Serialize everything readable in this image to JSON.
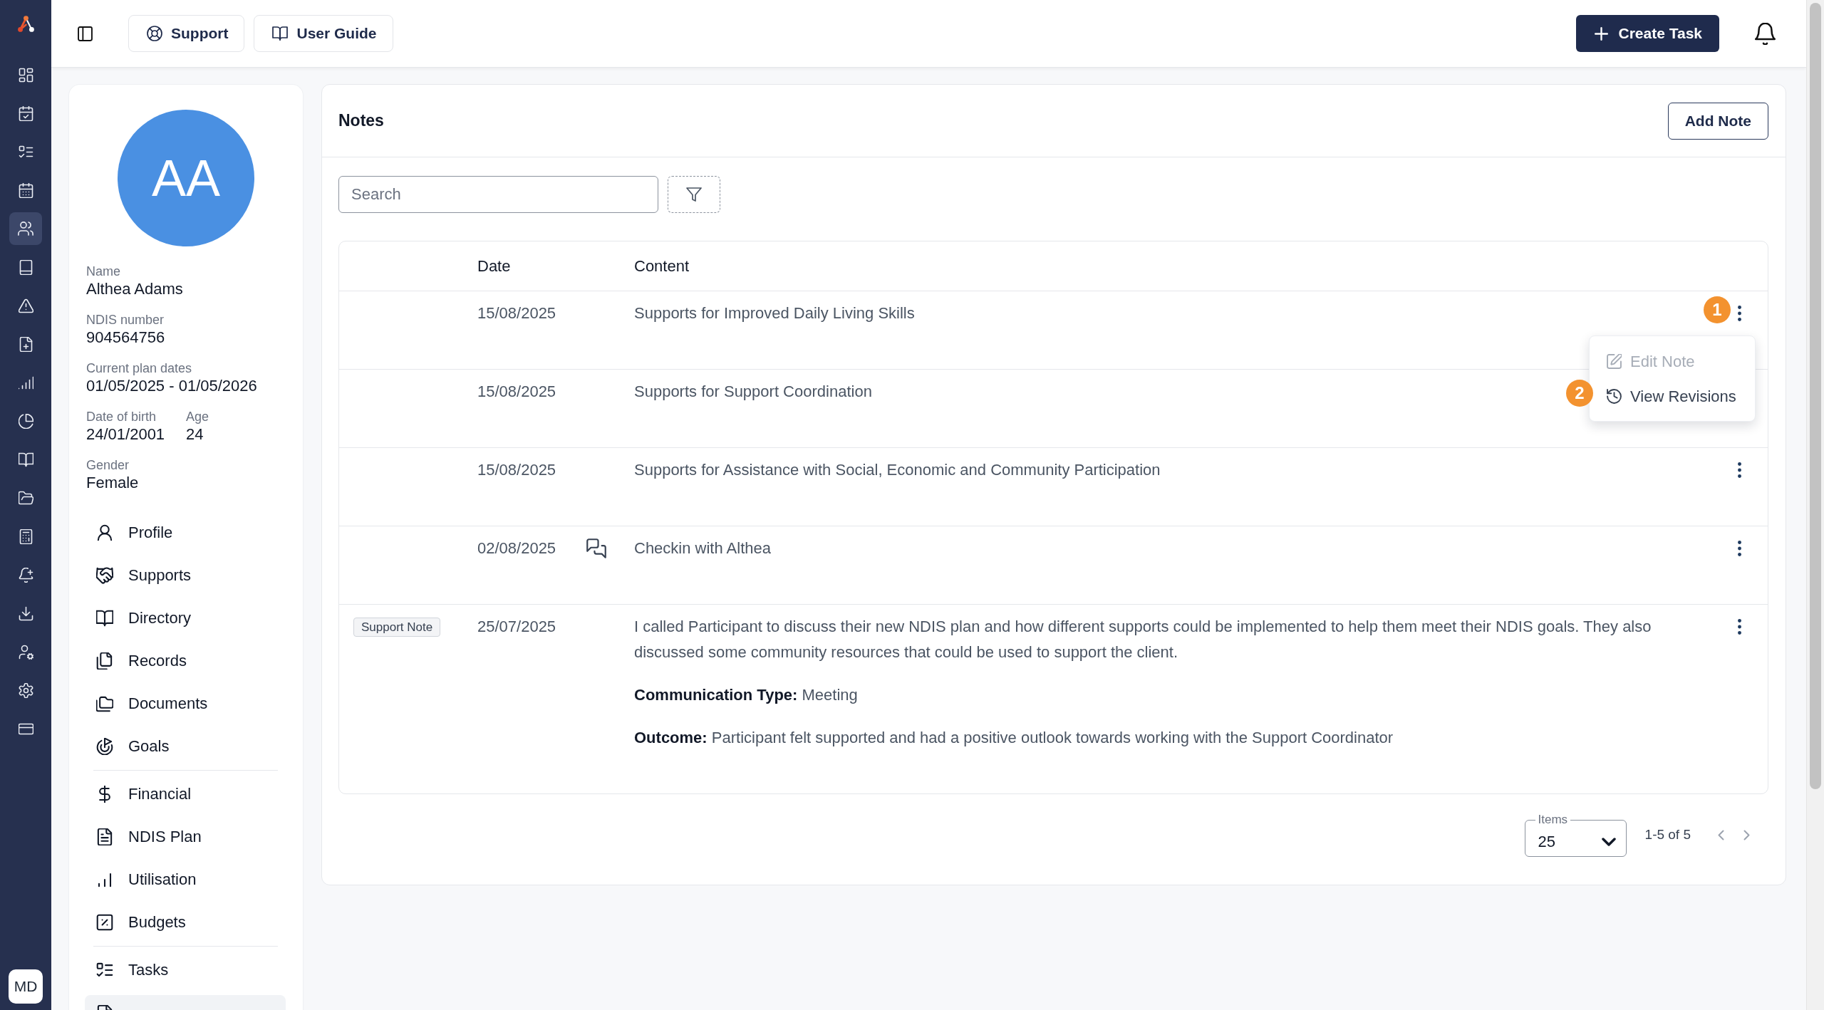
{
  "rail": {
    "items": [
      {
        "selected": false
      },
      {
        "selected": false
      },
      {
        "selected": false
      },
      {
        "selected": false
      },
      {
        "selected": true
      },
      {
        "selected": false
      },
      {
        "selected": false
      },
      {
        "selected": false
      },
      {
        "selected": false
      },
      {
        "selected": false
      },
      {
        "selected": false
      },
      {
        "selected": false
      },
      {
        "selected": false
      },
      {
        "selected": false
      },
      {
        "selected": false
      },
      {
        "selected": false
      },
      {
        "selected": false
      },
      {
        "selected": false
      }
    ],
    "user_initials": "MD"
  },
  "topbar": {
    "links": [
      {
        "label": "Support"
      },
      {
        "label": "User Guide"
      }
    ],
    "create_button": "Create Task"
  },
  "patient": {
    "initials": "AA",
    "fields": [
      [
        {
          "label": "Name",
          "value": "Althea Adams"
        }
      ],
      [
        {
          "label": "NDIS number",
          "value": "904564756"
        }
      ],
      [
        {
          "label": "Current plan dates",
          "value": "01/05/2025 - 01/05/2026"
        }
      ],
      [
        {
          "label": "Date of birth",
          "value": "24/01/2001"
        },
        {
          "label": "Age",
          "value": "24"
        }
      ],
      [
        {
          "label": "Gender",
          "value": "Female"
        }
      ]
    ],
    "nav": [
      [
        {
          "label": "Profile",
          "selected": false
        },
        {
          "label": "Supports",
          "selected": false
        },
        {
          "label": "Directory",
          "selected": false
        },
        {
          "label": "Records",
          "selected": false
        },
        {
          "label": "Documents",
          "selected": false
        },
        {
          "label": "Goals",
          "selected": false
        }
      ],
      [
        {
          "label": "Financial",
          "selected": false
        },
        {
          "label": "NDIS Plan",
          "selected": false
        },
        {
          "label": "Utilisation",
          "selected": false
        },
        {
          "label": "Budgets",
          "selected": false
        }
      ],
      [
        {
          "label": "Tasks",
          "selected": false
        },
        {
          "selected": true
        }
      ]
    ]
  },
  "notes": {
    "title": "Notes",
    "add_button": "Add Note",
    "search": {
      "placeholder": "Search"
    },
    "columns": {
      "date": "Date",
      "content": "Content"
    },
    "rows": [
      {
        "date": "15/08/2025",
        "comments": false,
        "content": [
          "Supports for Improved Daily Living Skills"
        ],
        "menu_open": true,
        "callout": "1"
      },
      {
        "date": "15/08/2025",
        "comments": false,
        "content": [
          "Supports for Support Coordination"
        ],
        "menu_open": false
      },
      {
        "date": "15/08/2025",
        "comments": false,
        "content": [
          "Supports for Assistance with Social, Economic and Community Participation"
        ],
        "menu_open": false
      },
      {
        "date": "02/08/2025",
        "comments": true,
        "content": [
          "Checkin with Althea"
        ],
        "menu_open": false
      },
      {
        "tag": "Support Note",
        "date": "25/07/2025",
        "comments": false,
        "content": [
          "I called Participant to discuss their new NDIS plan and how different supports could be implemented to help them meet their NDIS goals. They also discussed some community resources that could be used to support the client.",
          "**Communication Type:** Meeting",
          "**Outcome:** Participant felt supported and had a positive outlook towards working with the Support Coordinator"
        ],
        "menu_open": false
      }
    ],
    "row_menu": [
      {
        "label": "Edit Note",
        "disabled": true
      },
      {
        "label": "View Revisions",
        "disabled": false,
        "callout": "2"
      }
    ],
    "pagination": {
      "label": "Items",
      "page_size": "25",
      "range": "1-5 of 5"
    }
  }
}
